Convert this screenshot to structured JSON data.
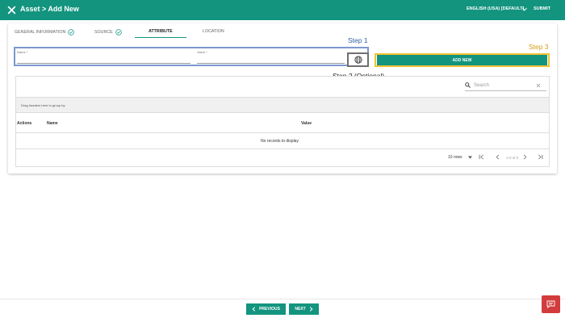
{
  "header": {
    "title": "Asset > Add New",
    "language": "ENGLISH (USA) [DEFAULT]",
    "submit_label": "SUBMIT",
    "color": "#13947f"
  },
  "tabs": [
    {
      "label": "GENERAL INFORMATION",
      "completed": true
    },
    {
      "label": "SOURCE",
      "completed": true
    },
    {
      "label": "ATTRIBUTE",
      "active": true
    },
    {
      "label": "LOCATION"
    }
  ],
  "annotations": {
    "step1": "Step 1",
    "step2": "Step 2 (Optional)",
    "step3": "Step 3"
  },
  "form": {
    "name_label": "Name *",
    "value_label": "Value *",
    "add_new_label": "ADD NEW"
  },
  "grid": {
    "search_placeholder": "Search",
    "group_hint": "Drag headers here to group by",
    "columns": [
      "Actions",
      "Name",
      "Value"
    ],
    "empty_text": "No records to display",
    "rows_per_page": "10 rows",
    "page_info": "1-0 of 0"
  },
  "footer": {
    "previous_label": "PREVIOUS",
    "next_label": "NEXT"
  },
  "colors": {
    "accent": "#13947f",
    "step1": "#2f5ea8",
    "step3": "#d59b14",
    "chat": "#d23c3c"
  }
}
